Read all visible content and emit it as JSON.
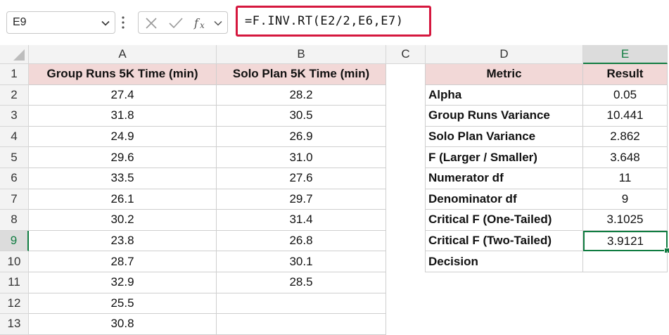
{
  "name_box": "E9",
  "formula": "=F.INV.RT(E2/2,E6,E7)",
  "col_headers": [
    "A",
    "B",
    "C",
    "D",
    "E"
  ],
  "row_numbers": [
    "1",
    "2",
    "3",
    "4",
    "5",
    "6",
    "7",
    "8",
    "9",
    "10",
    "11",
    "12",
    "13"
  ],
  "group_header": "Group Runs 5K Time (min)",
  "solo_header": "Solo Plan 5K Time (min)",
  "group_times": [
    "27.4",
    "31.8",
    "24.9",
    "29.6",
    "33.5",
    "26.1",
    "30.2",
    "23.8",
    "28.7",
    "32.9",
    "25.5",
    "30.8"
  ],
  "solo_times": [
    "28.2",
    "30.5",
    "26.9",
    "31.0",
    "27.6",
    "29.7",
    "31.4",
    "26.8",
    "30.1",
    "28.5"
  ],
  "metric_header": "Metric",
  "result_header": "Result",
  "metrics": [
    {
      "label": "Alpha",
      "value": "0.05"
    },
    {
      "label": "Group Runs Variance",
      "value": "10.441"
    },
    {
      "label": "Solo Plan Variance",
      "value": "2.862"
    },
    {
      "label": "F (Larger / Smaller)",
      "value": "3.648"
    },
    {
      "label": "Numerator df",
      "value": "11"
    },
    {
      "label": "Denominator df",
      "value": "9"
    },
    {
      "label": "Critical F (One-Tailed)",
      "value": "3.1025"
    },
    {
      "label": "Critical F (Two-Tailed)",
      "value": "3.9121"
    },
    {
      "label": "Decision",
      "value": ""
    }
  ],
  "icons": [
    "chevron-down-icon",
    "more-options-icon",
    "cancel-icon",
    "enter-icon",
    "insert-function-icon"
  ],
  "colors": {
    "accent_green": "#107c41",
    "header_fill": "#f2d8d7",
    "formula_border": "#d5173e"
  }
}
